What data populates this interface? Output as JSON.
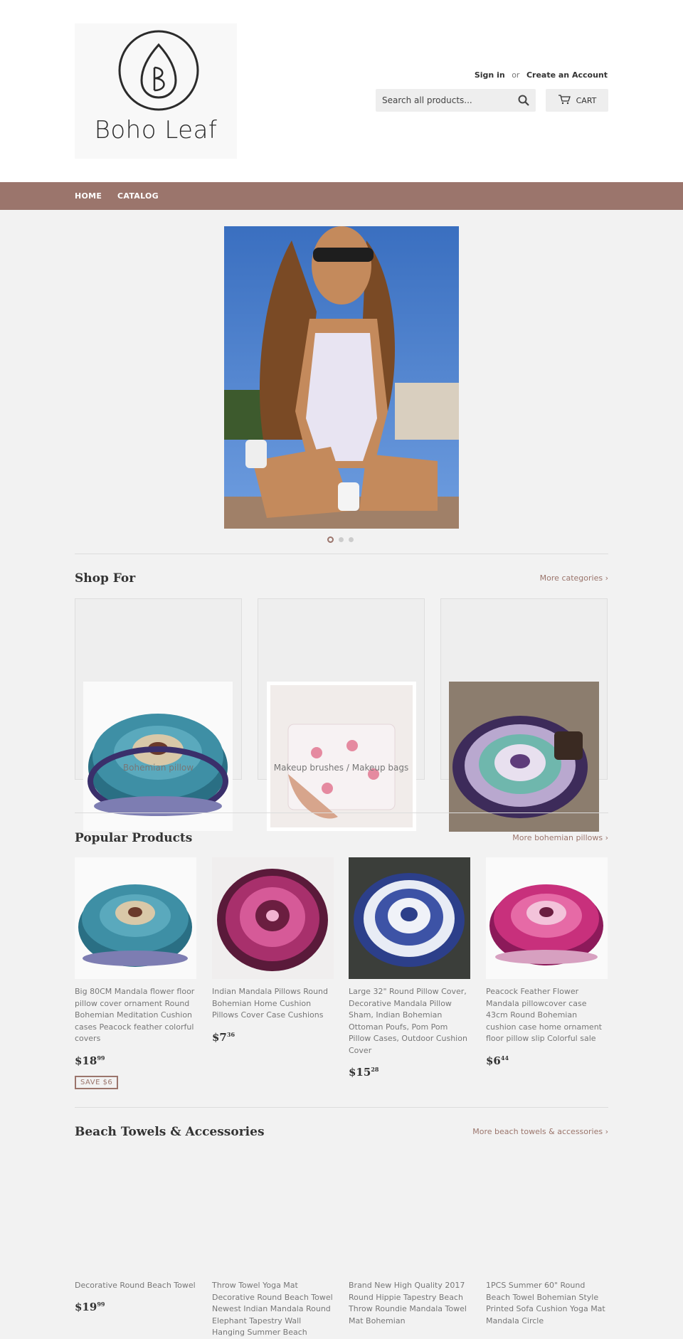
{
  "brand": {
    "name": "Boho Leaf",
    "accent": "#9b756c"
  },
  "header": {
    "sign_in": "Sign in",
    "or": "or",
    "create_account": "Create an Account",
    "search_placeholder": "Search all products...",
    "cart_label": "CART"
  },
  "nav": {
    "items": [
      "HOME",
      "CATALOG"
    ]
  },
  "slideshow": {
    "dots": 3,
    "active": 1
  },
  "shop_for": {
    "title": "Shop For",
    "more_link": "More categories ›",
    "categories": [
      {
        "label": "Bohemian pillow",
        "icon": "mandala-pillow-image"
      },
      {
        "label": "Makeup brushes / Makeup bags",
        "icon": "flamingo-bag-image"
      },
      {
        "label": "",
        "icon": "mandala-towel-image"
      }
    ]
  },
  "popular": {
    "title": "Popular Products",
    "more_link": "More bohemian pillows ›",
    "products": [
      {
        "title": "Big 80CM Mandala flower floor pillow cover ornament Round Bohemian Meditation Cushion cases Peacock feather colorful covers",
        "price_main": "$18",
        "price_cents": "99",
        "badge": "SAVE $6"
      },
      {
        "title": "Indian Mandala Pillows Round Bohemian Home Cushion Pillows Cover Case Cushions",
        "price_main": "$7",
        "price_cents": "36",
        "badge": ""
      },
      {
        "title": "Large 32\" Round Pillow Cover, Decorative Mandala Pillow Sham, Indian Bohemian Ottoman Poufs, Pom Pom Pillow Cases, Outdoor Cushion Cover",
        "price_main": "$15",
        "price_cents": "28",
        "badge": ""
      },
      {
        "title": "Peacock Feather Flower Mandala pillowcover case 43cm Round Bohemian cushion case home ornament floor pillow slip Colorful sale",
        "price_main": "$6",
        "price_cents": "44",
        "badge": ""
      }
    ]
  },
  "beach": {
    "title": "Beach Towels & Accessories",
    "more_link": "More beach towels & accessories ›",
    "products": [
      {
        "title": "Decorative Round Beach Towel",
        "price_main": "$19",
        "price_cents": "99"
      },
      {
        "title": "Throw Towel Yoga Mat Decorative Round Beach Towel Newest Indian Mandala Round Elephant Tapestry Wall Hanging Summer Beach",
        "price_main": "",
        "price_cents": ""
      },
      {
        "title": "Brand New High Quality 2017 Round Hippie Tapestry Beach Throw Roundie Mandala Towel Mat Bohemian",
        "price_main": "",
        "price_cents": ""
      },
      {
        "title": "1PCS Summer 60\" Round Beach Towel Bohemian Style Printed Sofa Cushion Yoga Mat Mandala Circle",
        "price_main": "",
        "price_cents": ""
      }
    ]
  }
}
